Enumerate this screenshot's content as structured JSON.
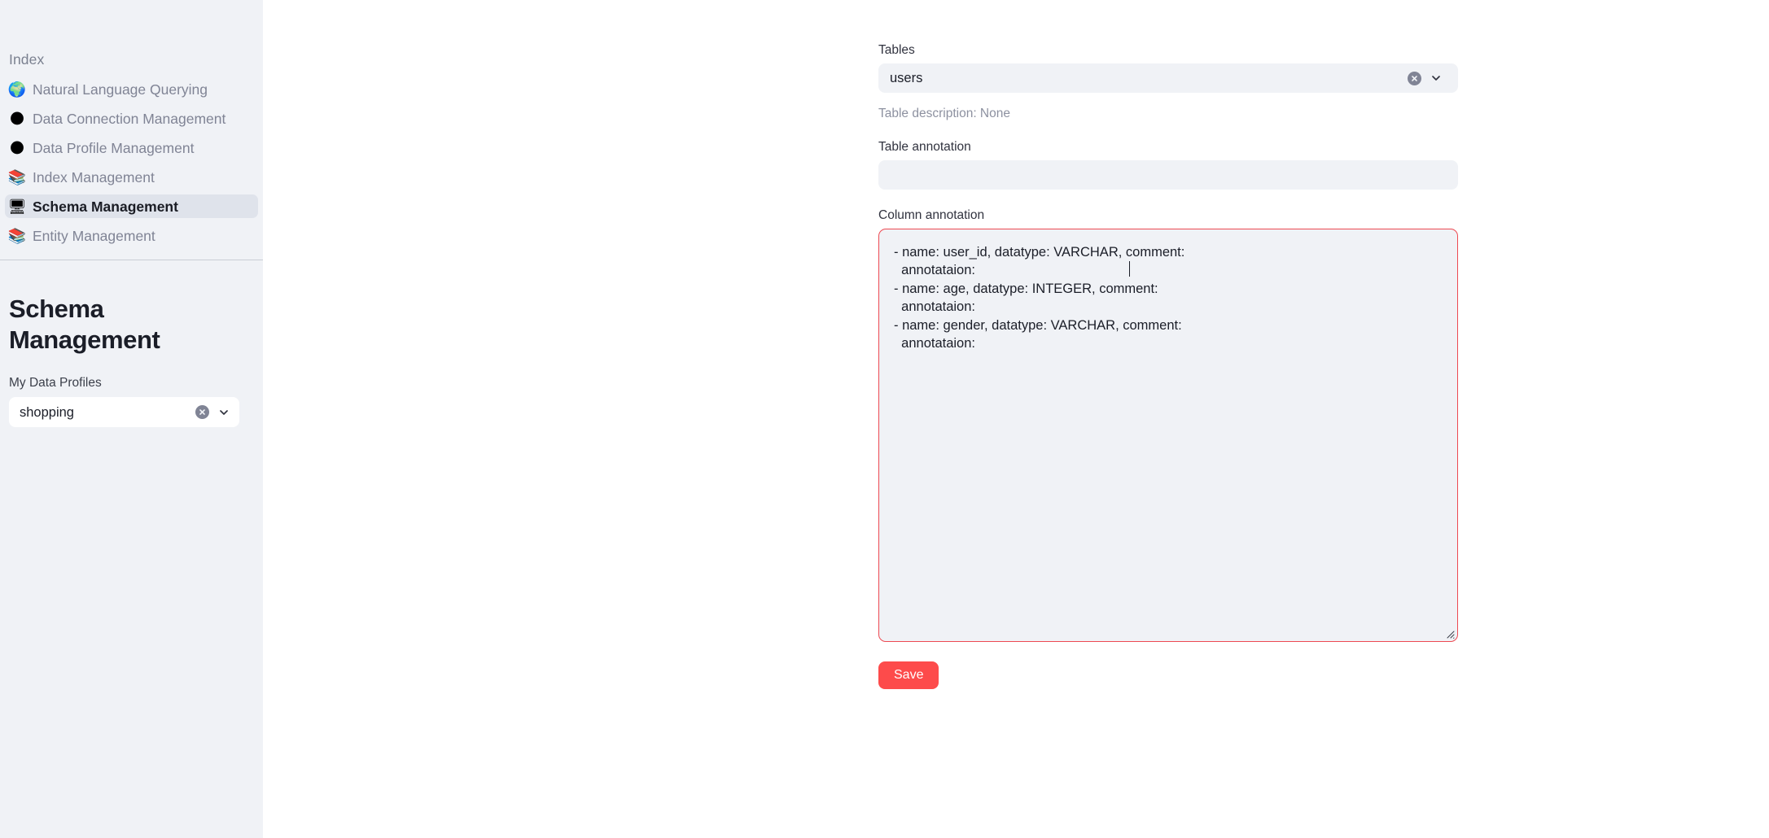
{
  "sidebar": {
    "nav_heading": "Index",
    "items": [
      {
        "label": "Natural Language Querying",
        "icon": "🌍",
        "icon_name": "globe-icon",
        "active": false
      },
      {
        "label": "Data Connection Management",
        "icon": "🌑",
        "icon_name": "globe-grey-icon",
        "active": false
      },
      {
        "label": "Data Profile Management",
        "icon": "🌑",
        "icon_name": "globe-grey-icon",
        "active": false
      },
      {
        "label": "Index Management",
        "icon": "📚",
        "icon_name": "books-icon",
        "active": false
      },
      {
        "label": "Schema Management",
        "icon": "🖥",
        "icon_name": "monitor-icon",
        "active": true
      },
      {
        "label": "Entity Management",
        "icon": "📚",
        "icon_name": "books-icon",
        "active": false
      }
    ],
    "page_title": "Schema Management",
    "profiles_label": "My Data Profiles",
    "profiles_value": "shopping",
    "profiles_placeholder": "Choose an option"
  },
  "main": {
    "tables_label": "Tables",
    "tables_value": "users",
    "tables_placeholder": "Choose an option",
    "table_description": "Table description: None",
    "table_annotation_label": "Table annotation",
    "table_annotation_value": "",
    "table_annotation_placeholder": "",
    "column_annotation_label": "Column annotation",
    "column_annotation_value": "- name: user_id, datatype: VARCHAR, comment:\n  annotataion:\n- name: age, datatype: INTEGER, comment:\n  annotataion:\n- name: gender, datatype: VARCHAR, comment:\n  annotataion:",
    "save_label": "Save"
  },
  "colors": {
    "accent": "#fd4b4b",
    "sidebar_bg": "#f0f2f6",
    "input_bg": "#f0f2f6",
    "active_item_bg": "#dfe3eb",
    "error_border": "#ed4a52",
    "muted_text": "#808495"
  }
}
